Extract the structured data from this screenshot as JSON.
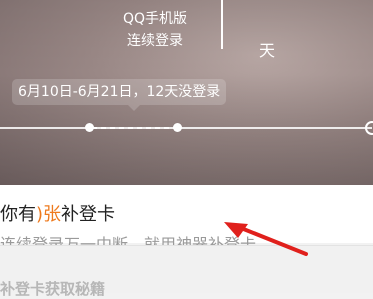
{
  "header": {
    "client_line1": "QQ手机版",
    "client_line2": "连续登录",
    "days_unit": "天"
  },
  "timeline": {
    "bubble_text": "6月10日-6月21日，12天没登录"
  },
  "card": {
    "title_prefix": "你有",
    "count": ")张",
    "title_suffix": "补登卡",
    "subtitle": "连续登录万一中断，就用神器补登卡。"
  },
  "section": {
    "title": "补登卡获取秘籍"
  },
  "colors": {
    "accent": "#ee7a1e",
    "arrow": "#e0201c"
  }
}
